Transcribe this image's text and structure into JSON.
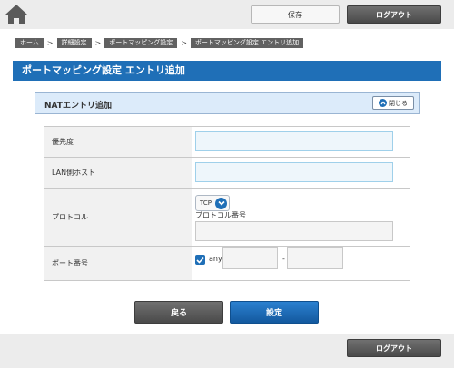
{
  "header": {
    "save_label": "保存",
    "logout_label": "ログアウト"
  },
  "breadcrumb": [
    "ホーム",
    "詳細設定",
    "ポートマッピング設定",
    "ポートマッピング設定 エントリ追加"
  ],
  "page_title": "ポートマッピング設定 エントリ追加",
  "section": {
    "title": "NATエントリ追加",
    "close_label": "閉じる"
  },
  "form": {
    "priority": {
      "label": "優先度",
      "value": ""
    },
    "lan_host": {
      "label": "LAN側ホスト",
      "value": ""
    },
    "protocol": {
      "label": "プロトコル",
      "selected": "TCP",
      "number_label": "プロトコル番号",
      "number_value": ""
    },
    "port": {
      "label": "ポート番号",
      "any_label": "any",
      "any_checked": true,
      "separator": "-",
      "from": "",
      "to": ""
    }
  },
  "buttons": {
    "back": "戻る",
    "apply": "設定"
  },
  "footer": {
    "logout_label": "ログアウト"
  },
  "colors": {
    "accent": "#1f6fb7",
    "section_bg": "#dcebfa",
    "input_bg": "#eef6fb"
  }
}
